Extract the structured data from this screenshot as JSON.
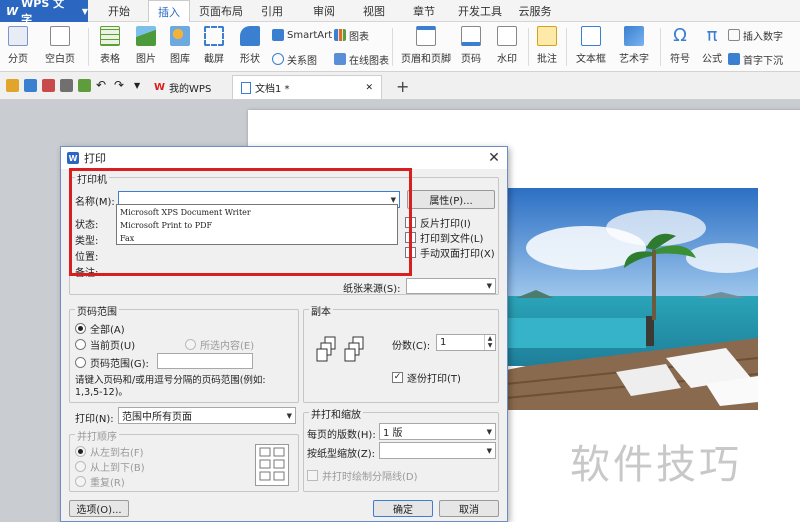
{
  "app": {
    "name": "WPS 文字"
  },
  "menu": [
    "开始",
    "插入",
    "页面布局",
    "引用",
    "审阅",
    "视图",
    "章节",
    "开发工具",
    "云服务"
  ],
  "menu_active": "插入",
  "ribbon": {
    "page_break": "分页",
    "blank_page": "空白页",
    "table": "表格",
    "picture": "图片",
    "gallery": "图库",
    "screenshot": "截屏",
    "shape": "形状",
    "smartart": "SmartArt",
    "chart": "图表",
    "relation": "关系图",
    "online_chart": "在线图表",
    "header_footer": "页眉和页脚",
    "page_number": "页码",
    "watermark": "水印",
    "comment": "批注",
    "textbox": "文本框",
    "wordart": "艺术字",
    "symbol": "符号",
    "formula": "公式",
    "insert_number": "插入数字",
    "dropcap": "首字下沉"
  },
  "tabs": {
    "mywps": "我的WPS",
    "doc": "文档1 *"
  },
  "document": {
    "watermark_text": "软件技巧"
  },
  "dialog": {
    "title": "打印",
    "printer_group": "打印机",
    "name_label": "名称(M):",
    "properties_button": "属性(P)...",
    "status_label": "状态:",
    "type_label": "类型:",
    "location_label": "位置:",
    "comment_label": "备注:",
    "printer_options": [
      "Microsoft XPS Document Writer",
      "Microsoft Print to PDF",
      "Fax"
    ],
    "reverse_print": "反片打印(I)",
    "print_to_file": "打印到文件(L)",
    "manual_duplex": "手动双面打印(X)",
    "paper_source_label": "纸张来源(S):",
    "page_range_group": "页码范围",
    "all": "全部(A)",
    "current_page": "当前页(U)",
    "selection": "所选内容(E)",
    "page_range": "页码范围(G):",
    "range_hint": "请键入页码和/或用逗号分隔的页码范围(例如: 1,3,5-12)。",
    "print_label": "打印(N):",
    "print_value": "范围中所有页面",
    "order_group": "并打顺序",
    "left_to_right": "从左到右(F)",
    "top_to_bottom": "从上到下(B)",
    "repeat": "重复(R)",
    "copies_group": "副本",
    "copies_label": "份数(C):",
    "copies_value": "1",
    "collate": "逐份打印(T)",
    "zoom_group": "并打和缩放",
    "pages_per_sheet_label": "每页的版数(H):",
    "pages_per_sheet_value": "1 版",
    "scale_label": "按纸型缩放(Z):",
    "draw_separator": "并打时绘制分隔线(D)",
    "options_button": "选项(O)...",
    "ok_button": "确定",
    "cancel_button": "取消"
  },
  "colors": {
    "brand_blue": "#2b66c0",
    "highlight_red": "#d81e1e"
  }
}
